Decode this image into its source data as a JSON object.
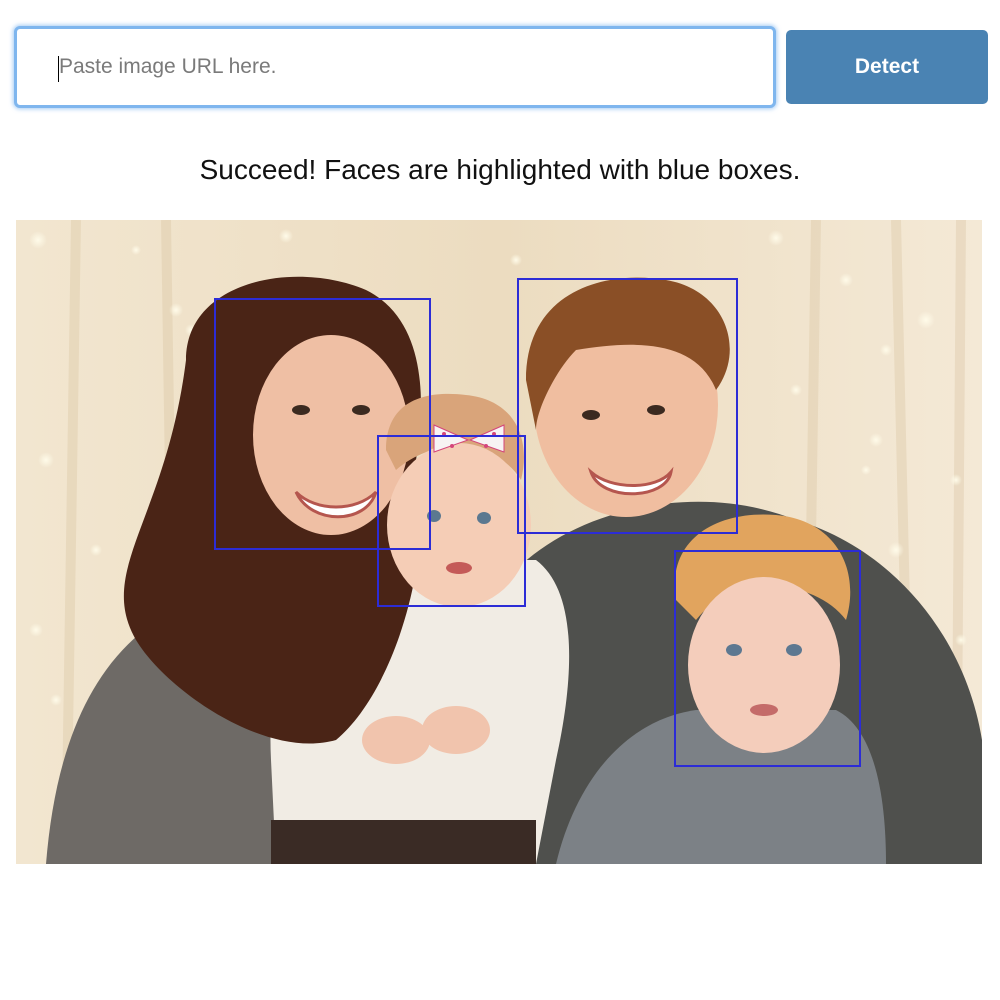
{
  "search": {
    "placeholder": "Paste image URL here.",
    "value": ""
  },
  "detect_button": {
    "label": "Detect",
    "color": "#4a83b3"
  },
  "status": {
    "text": "Succeed! Faces are highlighted with blue boxes."
  },
  "photo": {
    "face_box_color": "#2c2cd6",
    "faces_detected": 4
  }
}
